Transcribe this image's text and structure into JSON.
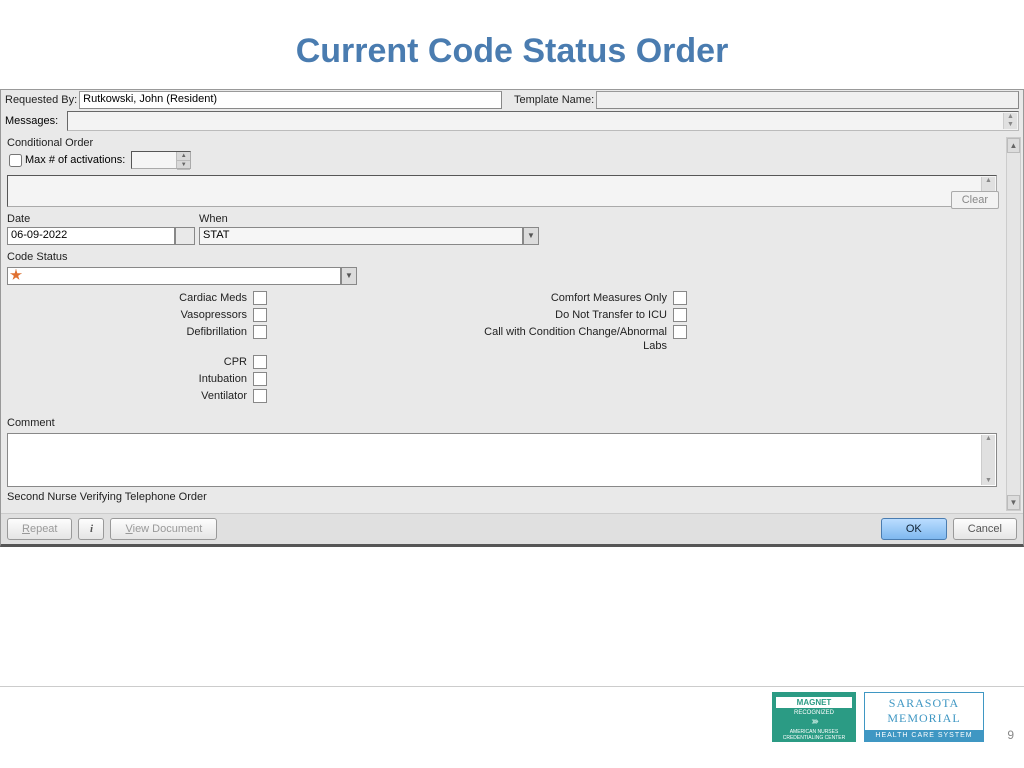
{
  "slide": {
    "title": "Current Code Status Order",
    "page_number": "9"
  },
  "header": {
    "requested_by_label": "Requested By:",
    "requested_by_value": "Rutkowski, John (Resident)",
    "template_name_label": "Template Name:",
    "template_name_value": "",
    "messages_label": "Messages:"
  },
  "conditional": {
    "group_label": "Conditional Order",
    "max_activations_label": "Max # of activations:",
    "max_activations_value": "",
    "clear_button": "Clear"
  },
  "date_when": {
    "date_label": "Date",
    "date_value": "06-09-2022",
    "when_label": "When",
    "when_value": "STAT"
  },
  "code_status": {
    "label": "Code Status",
    "value": ""
  },
  "checks": {
    "left": [
      "Cardiac Meds",
      "Vasopressors",
      "Defibrillation",
      "",
      "CPR",
      "Intubation",
      "Ventilator"
    ],
    "right": [
      "Comfort Measures Only",
      "Do Not Transfer to ICU",
      "Call with Condition Change/Abnormal Labs"
    ]
  },
  "comment": {
    "label": "Comment",
    "value": ""
  },
  "nurse_verify": "Second Nurse Verifying Telephone Order",
  "buttons": {
    "repeat": "Repeat",
    "view_document": "View Document",
    "ok": "OK",
    "cancel": "Cancel"
  },
  "logos": {
    "magnet_top": "MAGNET",
    "magnet_sub": "RECOGNIZED",
    "magnet_small": "AMERICAN NURSES CREDENTIALING CENTER",
    "sarasota1": "SARASOTA",
    "sarasota2": "MEMORIAL",
    "sarasota3": "HEALTH CARE SYSTEM"
  }
}
